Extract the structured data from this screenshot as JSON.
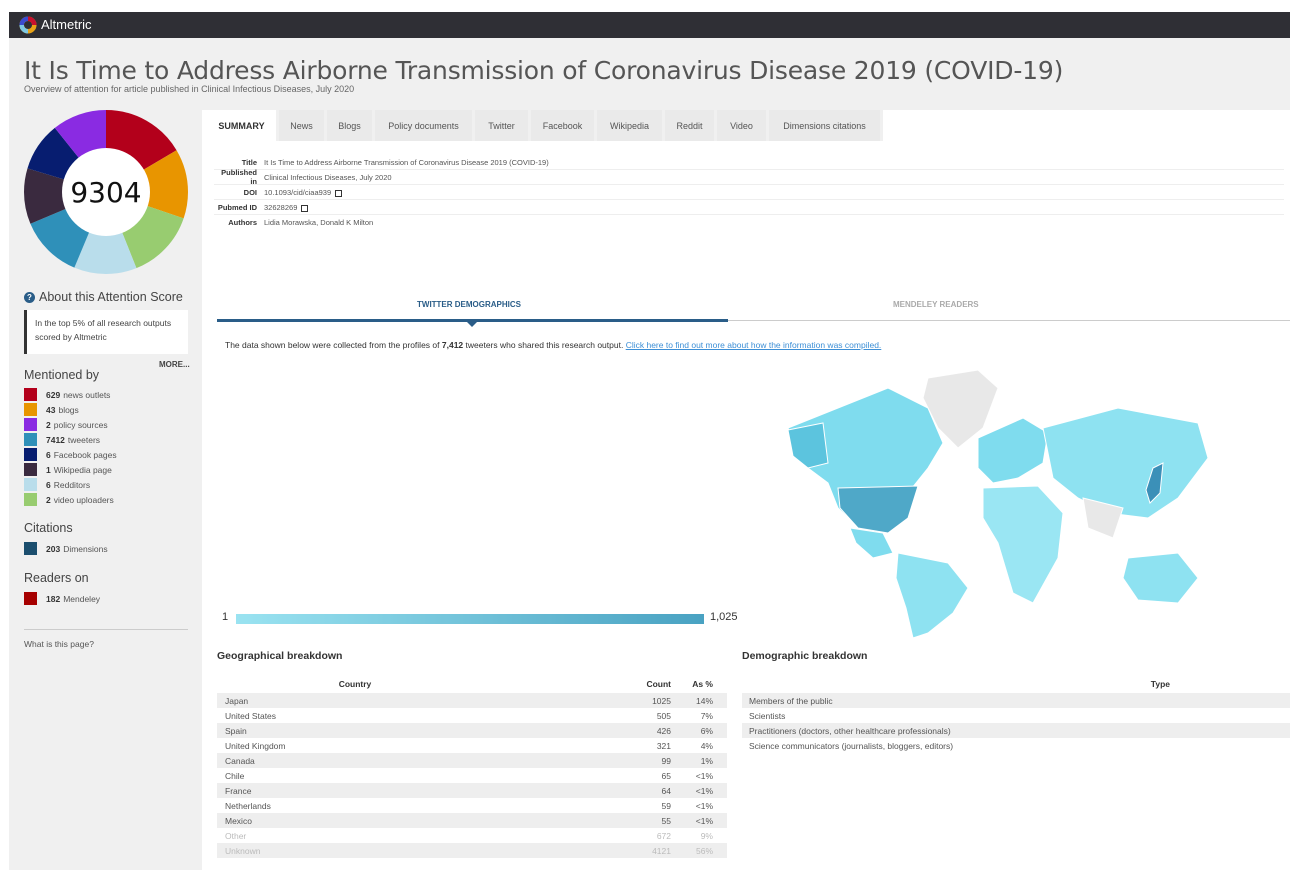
{
  "topbar": {
    "brand": "Altmetric"
  },
  "article": {
    "title": "It Is Time to Address Airborne Transmission of Coronavirus Disease 2019 (COVID-19)",
    "subtitle": "Overview of attention for article published in Clinical Infectious Diseases, July 2020"
  },
  "score": {
    "value": "9304"
  },
  "sidebar": {
    "about_label": "About this Attention Score",
    "top_text": "In the top 5% of all research outputs scored by Altmetric",
    "more_label": "MORE...",
    "mentioned_heading": "Mentioned by",
    "mentions": [
      {
        "count": "629",
        "label": "news outlets",
        "color": "#b3001b"
      },
      {
        "count": "43",
        "label": "blogs",
        "color": "#e89500"
      },
      {
        "count": "2",
        "label": "policy sources",
        "color": "#8a2be2"
      },
      {
        "count": "7412",
        "label": "tweeters",
        "color": "#2f90b9"
      },
      {
        "count": "6",
        "label": "Facebook pages",
        "color": "#071d70"
      },
      {
        "count": "1",
        "label": "Wikipedia page",
        "color": "#3a2a3f"
      },
      {
        "count": "6",
        "label": "Redditors",
        "color": "#b9ddeb"
      },
      {
        "count": "2",
        "label": "video uploaders",
        "color": "#98cc70"
      }
    ],
    "citations_heading": "Citations",
    "citations": [
      {
        "count": "203",
        "label": "Dimensions",
        "color": "#1b4e6e"
      }
    ],
    "readers_heading": "Readers on",
    "readers": [
      {
        "count": "182",
        "label": "Mendeley",
        "color": "#a60000"
      }
    ],
    "what_is": "What is this page?"
  },
  "tabs": [
    "SUMMARY",
    "News",
    "Blogs",
    "Policy documents",
    "Twitter",
    "Facebook",
    "Wikipedia",
    "Reddit",
    "Video",
    "Dimensions citations"
  ],
  "details": {
    "title_label": "Title",
    "title_value": "It Is Time to Address Airborne Transmission of Coronavirus Disease 2019 (COVID-19)",
    "published_label": "Published in",
    "published_value": "Clinical Infectious Diseases, July 2020",
    "doi_label": "DOI",
    "doi_value": "10.1093/cid/ciaa939",
    "pubmed_label": "Pubmed ID",
    "pubmed_value": "32628269",
    "authors_label": "Authors",
    "authors_value": "Lidia Morawska, Donald K Milton"
  },
  "demographics": {
    "tab_twitter": "TWITTER DEMOGRAPHICS",
    "tab_mendeley": "MENDELEY READERS",
    "note_prefix": "The data shown below were collected from the profiles of ",
    "note_count": "7,412",
    "note_suffix": " tweeters who shared this research output. ",
    "note_link": "Click here to find out more about how the information was compiled.",
    "legend_min": "1",
    "legend_max": "1,025"
  },
  "geo": {
    "heading": "Geographical breakdown",
    "col_country": "Country",
    "col_count": "Count",
    "col_pct": "As %",
    "rows": [
      {
        "country": "Japan",
        "count": "1025",
        "pct": "14%"
      },
      {
        "country": "United States",
        "count": "505",
        "pct": "7%"
      },
      {
        "country": "Spain",
        "count": "426",
        "pct": "6%"
      },
      {
        "country": "United Kingdom",
        "count": "321",
        "pct": "4%"
      },
      {
        "country": "Canada",
        "count": "99",
        "pct": "1%"
      },
      {
        "country": "Chile",
        "count": "65",
        "pct": "<1%"
      },
      {
        "country": "France",
        "count": "64",
        "pct": "<1%"
      },
      {
        "country": "Netherlands",
        "count": "59",
        "pct": "<1%"
      },
      {
        "country": "Mexico",
        "count": "55",
        "pct": "<1%"
      },
      {
        "country": "Other",
        "count": "672",
        "pct": "9%"
      },
      {
        "country": "Unknown",
        "count": "4121",
        "pct": "56%"
      }
    ]
  },
  "demo": {
    "heading": "Demographic breakdown",
    "col_type": "Type",
    "rows": [
      "Members of the public",
      "Scientists",
      "Practitioners (doctors, other healthcare professionals)",
      "Science communicators (journalists, bloggers, editors)"
    ]
  }
}
